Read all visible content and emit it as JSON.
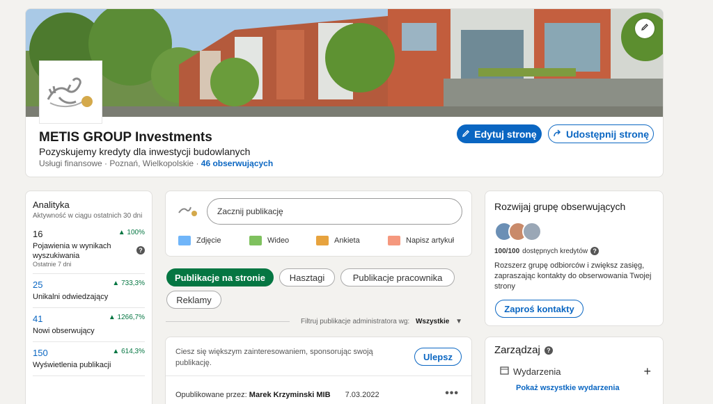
{
  "company": {
    "name": "METIS GROUP Investments",
    "tagline": "Pozyskujemy kredyty dla inwestycji budowlanych",
    "meta_prefix": "Usługi finansowe · Poznań, Wielkopolskie · ",
    "followers": "46 obserwujących",
    "edit_button": "Edytuj stronę",
    "share_button": "Udostępnij stronę"
  },
  "analytics": {
    "title": "Analityka",
    "subtitle": "Aktywność w ciągu ostatnich 30 dni",
    "stats": [
      {
        "value": "16",
        "change": "▲ 100%",
        "label": "Pojawienia w wynikach wyszukiwania",
        "note": "Ostatnie 7 dni"
      },
      {
        "value": "25",
        "change": "▲ 733,3%",
        "label": "Unikalni odwiedzający"
      },
      {
        "value": "41",
        "change": "▲ 1266,7%",
        "label": "Nowi obserwujący"
      },
      {
        "value": "150",
        "change": "▲ 614,3%",
        "label": "Wyświetlenia publikacji"
      }
    ]
  },
  "composer": {
    "placeholder": "Zacznij publikację",
    "actions": [
      "Zdjęcie",
      "Wideo",
      "Ankieta",
      "Napisz artykuł"
    ]
  },
  "filters": {
    "pills": [
      "Publikacje na stronie",
      "Hasztagi",
      "Publikacje pracownika",
      "Reklamy"
    ],
    "label": "Filtruj publikacje administratora wg:",
    "value": "Wszystkie"
  },
  "feed": {
    "sponsor_text": "Ciesz się większym zainteresowaniem, sponsorując swoją publikację.",
    "upgrade": "Ulepsz",
    "published_prefix": "Opublikowane przez:",
    "author": "Marek Krzyminski MIB",
    "date": "7.03.2022"
  },
  "grow": {
    "title": "Rozwijaj grupę obserwujących",
    "credits_bold": "100/100",
    "credits_rest": "dostępnych kredytów",
    "description": "Rozszerz grupę odbiorców i zwiększ zasięg, zapraszając kontakty do obserwowania Twojej strony",
    "invite": "Zaproś kontakty"
  },
  "manage": {
    "title": "Zarządzaj",
    "events": "Wydarzenia",
    "show_all": "Pokaż wszystkie wydarzenia"
  },
  "colors": {
    "accent": "#0a66c2",
    "active_pill": "#057642"
  }
}
